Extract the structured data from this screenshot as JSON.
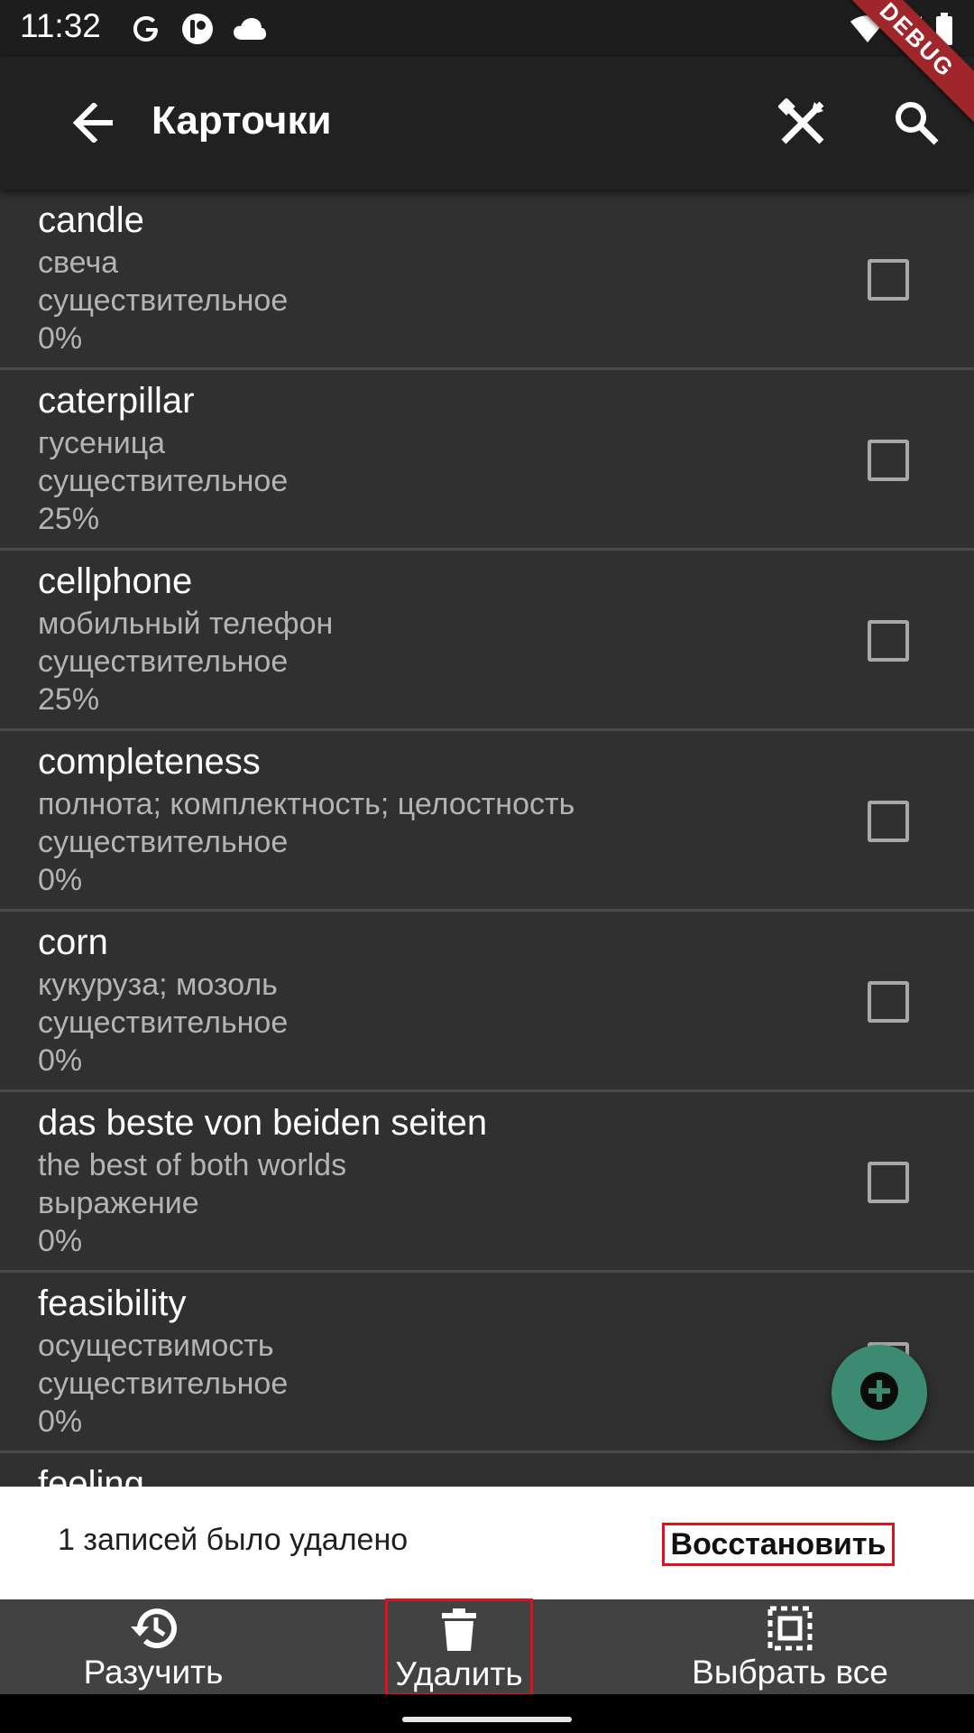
{
  "status_bar": {
    "time": "11:32",
    "icons": [
      "google-icon",
      "app-notification-icon",
      "cloud-icon",
      "wifi-icon",
      "signal-icon",
      "battery-icon"
    ],
    "debug_label": "DEBUG"
  },
  "app_bar": {
    "title": "Карточки",
    "icons": [
      "back-arrow-icon",
      "tools-icon",
      "search-icon"
    ]
  },
  "cards": [
    {
      "word": "candle",
      "translation": "свеча",
      "part_of_speech": "существительное",
      "progress": "0%"
    },
    {
      "word": "caterpillar",
      "translation": "гусеница",
      "part_of_speech": "существительное",
      "progress": "25%"
    },
    {
      "word": "cellphone",
      "translation": "мобильный телефон",
      "part_of_speech": "существительное",
      "progress": "25%"
    },
    {
      "word": "completeness",
      "translation": "полнота; комплектность; целостность",
      "part_of_speech": "существительное",
      "progress": "0%"
    },
    {
      "word": "corn",
      "translation": "кукуруза; мозоль",
      "part_of_speech": "существительное",
      "progress": "0%"
    },
    {
      "word": "das beste von beiden seiten",
      "translation": "the best of both worlds",
      "part_of_speech": "выражение",
      "progress": "0%"
    },
    {
      "word": "feasibility",
      "translation": "осуществимость",
      "part_of_speech": "существительное",
      "progress": "0%"
    },
    {
      "word": "feeling",
      "translation": "",
      "part_of_speech": "",
      "progress": ""
    }
  ],
  "fab": {
    "icon": "add-circle-icon"
  },
  "snackbar": {
    "message": "1 записей было удалено",
    "action": "Восстановить"
  },
  "bottom_nav": {
    "learn": "Разучить",
    "delete": "Удалить",
    "select_all": "Выбрать все"
  },
  "colors": {
    "background": "#303030",
    "app_bar": "#212121",
    "fab": "#3d8a73",
    "highlight": "#e0101e",
    "bottom_nav": "#424242"
  }
}
